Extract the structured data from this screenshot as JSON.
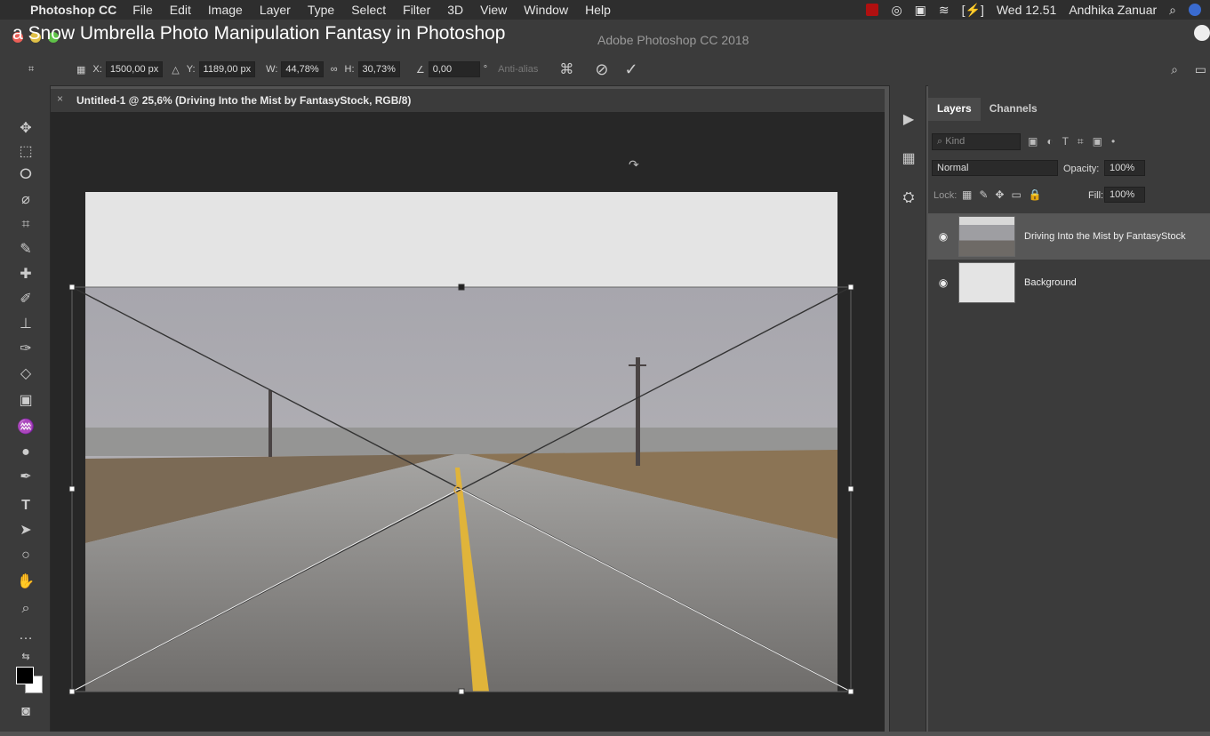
{
  "menubar": {
    "apple_icon": "apple-icon",
    "app_name": "Photoshop CC",
    "menus": [
      "File",
      "Edit",
      "Image",
      "Layer",
      "Type",
      "Select",
      "Filter",
      "3D",
      "View",
      "Window",
      "Help"
    ],
    "clock": "Wed 12.51",
    "user": "Andhika Zanuar"
  },
  "overlay": {
    "title": "a Snow Umbrella Photo Manipulation Fantasy in Photoshop"
  },
  "window": {
    "app_title": "Adobe Photoshop CC 2018"
  },
  "options": {
    "x_label": "X:",
    "x_value": "1500,00 px",
    "y_label": "Y:",
    "y_value": "1189,00 px",
    "w_label": "W:",
    "w_value": "44,78%",
    "h_label": "H:",
    "h_value": "30,73%",
    "angle_value": "0,00",
    "degree": "°",
    "antialias": "Anti-alias"
  },
  "document": {
    "tab_title": "Untitled-1 @ 25,6% (Driving Into the Mist by FantasyStock, RGB/8)"
  },
  "panel": {
    "tabs": [
      "Layers",
      "Channels"
    ],
    "kind_placeholder": "Kind",
    "blend_mode": "Normal",
    "opacity_label": "Opacity:",
    "opacity_value": "100%",
    "lock_label": "Lock:",
    "fill_label": "Fill:",
    "fill_value": "100%",
    "layers": [
      {
        "name": "Driving Into the Mist by FantasyStock",
        "selected": true
      },
      {
        "name": "Background",
        "selected": false
      }
    ]
  },
  "colors": {
    "road_line": "#e0b43a",
    "canvas_white": "#e4e4e4",
    "fog_sky": "#a9a8ad"
  }
}
